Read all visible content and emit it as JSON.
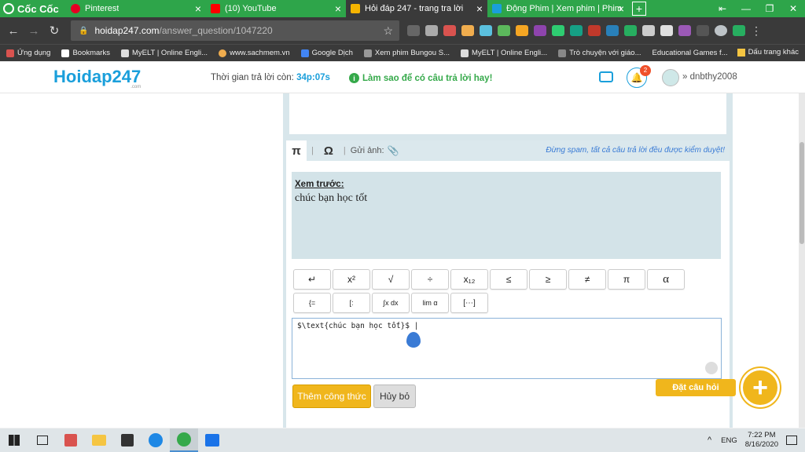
{
  "browser": {
    "brand": "Cốc Cốc",
    "tabs": [
      {
        "title": "Pinterest",
        "color": "#e60023"
      },
      {
        "title": "(10) YouTube",
        "color": "#ff0000"
      },
      {
        "title": "Hỏi đáp 247 - trang tra lời",
        "color": "#f5b400"
      },
      {
        "title": "Động Phim | Xem phim | Phim",
        "color": "#1a9fdb"
      }
    ],
    "url_host": "hoidap247.com",
    "url_path": "/answer_question/1047220",
    "bookmarks": [
      "Ứng dụng",
      "Bookmarks",
      "MyELT | Online Engli...",
      "www.sachmem.vn",
      "Google Dịch",
      "Xem phim Bungou S...",
      "MyELT | Online Engli...",
      "Trò chuyện với giáo...",
      "Educational Games f..."
    ],
    "bookmarks_other": "Dấu trang khác"
  },
  "site": {
    "logo": "Hoidap247",
    "logo_sub": ".com",
    "timer_label": "Thời gian trả lời còn:",
    "timer_value": "34p:07s",
    "howto": "Làm sao để có câu trả lời hay!",
    "notif_count": "2",
    "username": "dnbthy2008"
  },
  "editor": {
    "pi": "π",
    "omega": "Ω",
    "attach_label": "Gửi ảnh:",
    "notice": "Đừng spam, tất cả câu trả lời đều được kiểm duyệt!",
    "preview_title": "Xem trước:",
    "preview_text": "chúc bạn học tốt",
    "math_row1": [
      "↵",
      "x²",
      "√",
      "÷",
      "x₁₂",
      "≤",
      "≥",
      "≠",
      "π",
      "α"
    ],
    "math_row2": [
      "{=",
      "[:",
      "∫x dx",
      "lim α",
      "[⋯]"
    ],
    "tex_value": "$\\text{chúc bạn học tốt}$ |",
    "add_formula": "Thêm công thức",
    "cancel": "Hủy bỏ"
  },
  "ask": {
    "label": "Đặt câu hỏi",
    "fab": "+"
  },
  "taskbar": {
    "lang": "ENG",
    "time": "7:22 PM",
    "date": "8/16/2020"
  }
}
